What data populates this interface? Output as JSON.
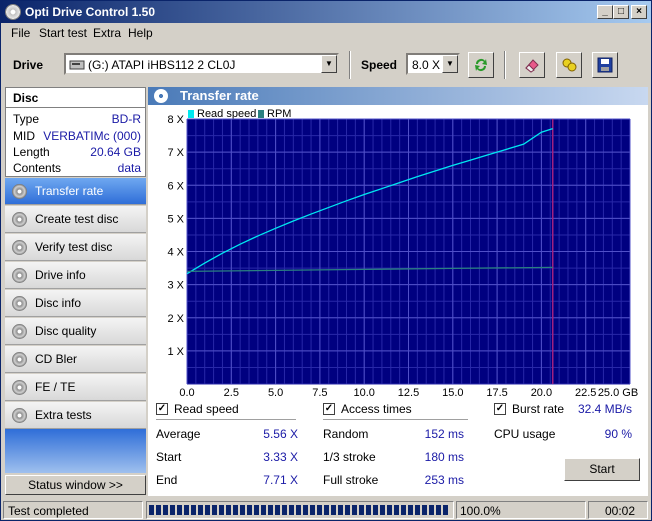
{
  "window": {
    "title": "Opti Drive Control 1.50",
    "min": "_",
    "max": "□",
    "close": "×"
  },
  "menu": [
    "File",
    "Start test",
    "Extra",
    "Help"
  ],
  "toolbar": {
    "drive_label": "Drive",
    "drive_value": "(G:)   ATAPI iHBS112   2 CL0J",
    "speed_label": "Speed",
    "speed_value": "8.0 X"
  },
  "disc": {
    "header": "Disc",
    "rows": [
      {
        "key": "Type",
        "value": "BD-R"
      },
      {
        "key": "MID",
        "value": "VERBATIMc (000)"
      },
      {
        "key": "Length",
        "value": "20.64 GB"
      },
      {
        "key": "Contents",
        "value": "data"
      }
    ]
  },
  "nav": [
    {
      "label": "Transfer rate",
      "active": true
    },
    {
      "label": "Create test disc"
    },
    {
      "label": "Verify test disc"
    },
    {
      "label": "Drive info"
    },
    {
      "label": "Disc info"
    },
    {
      "label": "Disc quality"
    },
    {
      "label": "CD Bler"
    },
    {
      "label": "FE / TE"
    },
    {
      "label": "Extra tests"
    }
  ],
  "status_window_label": "Status window >>",
  "panel": {
    "title": "Transfer rate"
  },
  "chart_data": {
    "type": "line",
    "series": [
      {
        "name": "Read speed",
        "color": "#00e8f0",
        "x": [
          0,
          1,
          2,
          3,
          4,
          5,
          6,
          7,
          8,
          9,
          10,
          11,
          12,
          13,
          14,
          15,
          16,
          17,
          18,
          19,
          20,
          20.64
        ],
        "y": [
          3.33,
          3.65,
          3.95,
          4.22,
          4.47,
          4.7,
          4.92,
          5.13,
          5.33,
          5.53,
          5.72,
          5.9,
          6.08,
          6.26,
          6.43,
          6.6,
          6.76,
          6.92,
          7.08,
          7.24,
          7.6,
          7.71
        ]
      },
      {
        "name": "RPM",
        "color": "#2a8080",
        "x": [
          0,
          5,
          10,
          15,
          20.64
        ],
        "y": [
          3.4,
          3.43,
          3.46,
          3.49,
          3.52
        ]
      }
    ],
    "xlabel": "",
    "ylabel": "",
    "x_ticks": [
      "0.0",
      "2.5",
      "5.0",
      "7.5",
      "10.0",
      "12.5",
      "15.0",
      "17.5",
      "20.0",
      "22.5",
      "25.0 GB"
    ],
    "y_ticks": [
      "1 X",
      "2 X",
      "3 X",
      "4 X",
      "5 X",
      "6 X",
      "7 X",
      "8 X"
    ],
    "xlim": [
      0,
      25
    ],
    "ylim": [
      0,
      8
    ],
    "end_marker": 20.64,
    "grid": true,
    "legend": "top-left",
    "background": "#000080",
    "grid_color": "#2828a8"
  },
  "stats": {
    "read_speed_label": "Read speed",
    "access_times_label": "Access times",
    "burst_rate_label": "Burst rate",
    "burst_rate_value": "32.4 MB/s",
    "average_label": "Average",
    "average_value": "5.56 X",
    "start_label": "Start",
    "start_value": "3.33 X",
    "end_label": "End",
    "end_value": "7.71 X",
    "random_label": "Random",
    "random_value": "152 ms",
    "third_label": "1/3 stroke",
    "third_value": "180 ms",
    "full_label": "Full stroke",
    "full_value": "253 ms",
    "cpu_label": "CPU usage",
    "cpu_value": "90 %",
    "check_mark": "✓",
    "start_button": "Start"
  },
  "statusbar": {
    "text": "Test completed",
    "progress_text": "100.0%",
    "progress_fraction": 1.0,
    "elapsed": "00:02"
  }
}
